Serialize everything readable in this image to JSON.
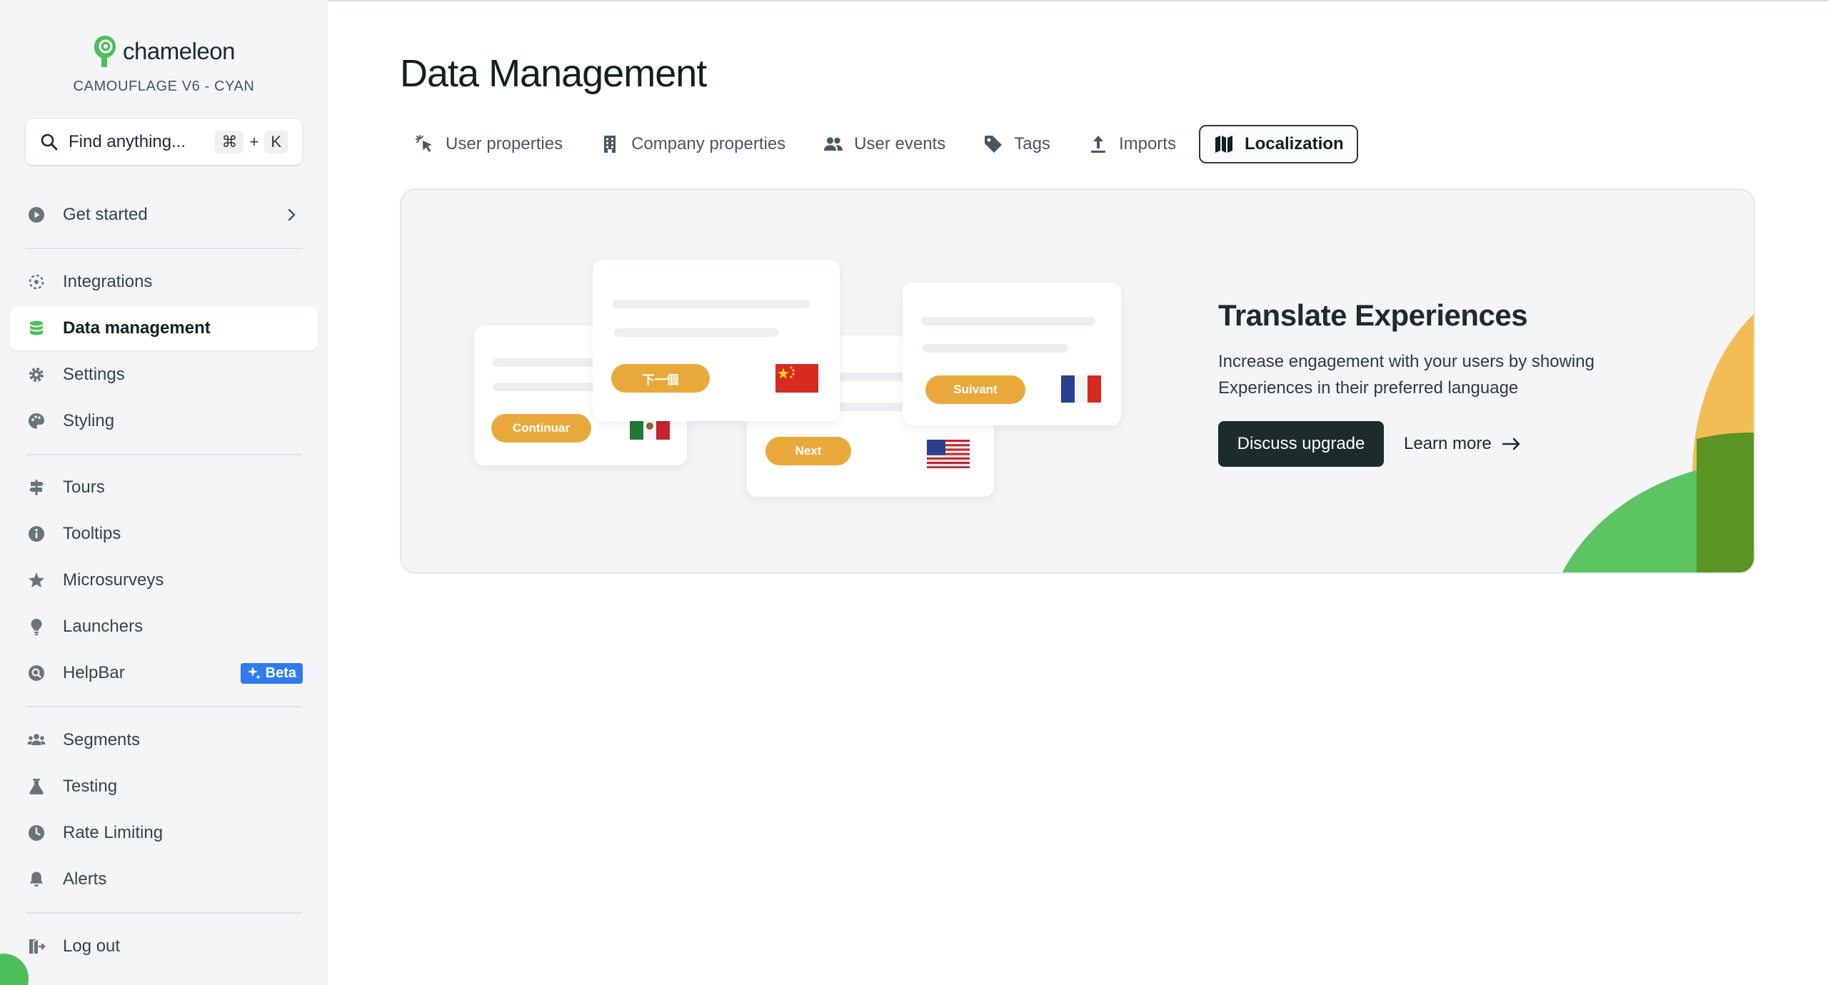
{
  "brand": {
    "name": "chameleon",
    "workspace": "CAMOUFLAGE V6 - CYAN"
  },
  "search": {
    "placeholder": "Find anything...",
    "shortcut_mod": "⌘",
    "shortcut_plus": "+",
    "shortcut_key": "K"
  },
  "sidebar": {
    "get_started": "Get started",
    "items": [
      {
        "label": "Integrations",
        "icon": "integrations-icon"
      },
      {
        "label": "Data management",
        "icon": "database-icon",
        "active": true
      },
      {
        "label": "Settings",
        "icon": "gear-icon"
      },
      {
        "label": "Styling",
        "icon": "palette-icon"
      },
      {
        "label": "Tours",
        "icon": "signpost-icon"
      },
      {
        "label": "Tooltips",
        "icon": "info-icon"
      },
      {
        "label": "Microsurveys",
        "icon": "star-icon"
      },
      {
        "label": "Launchers",
        "icon": "lightbulb-icon"
      },
      {
        "label": "HelpBar",
        "icon": "helpbar-icon",
        "badge": "Beta"
      },
      {
        "label": "Segments",
        "icon": "users-icon"
      },
      {
        "label": "Testing",
        "icon": "flask-icon"
      },
      {
        "label": "Rate Limiting",
        "icon": "clock-icon"
      },
      {
        "label": "Alerts",
        "icon": "bell-icon"
      },
      {
        "label": "Log out",
        "icon": "logout-icon"
      }
    ]
  },
  "main": {
    "title": "Data Management",
    "tabs": [
      {
        "label": "User properties",
        "icon": "pointer-click-icon"
      },
      {
        "label": "Company properties",
        "icon": "building-icon"
      },
      {
        "label": "User events",
        "icon": "users-icon"
      },
      {
        "label": "Tags",
        "icon": "tag-icon"
      },
      {
        "label": "Imports",
        "icon": "upload-icon"
      },
      {
        "label": "Localization",
        "icon": "map-icon",
        "active": true
      }
    ]
  },
  "promo": {
    "title": "Translate Experiences",
    "description": "Increase engagement with your users by showing Experiences in their preferred language",
    "cta_label": "Discuss upgrade",
    "learn_label": "Learn more",
    "cards": [
      {
        "button": "Continuar",
        "flag": "mexico-flag"
      },
      {
        "button": "下一個",
        "flag": "china-flag"
      },
      {
        "button": "Next",
        "flag": "usa-flag"
      },
      {
        "button": "Suivant",
        "flag": "france-flag"
      }
    ]
  },
  "colors": {
    "accent_green": "#4dbf5a",
    "pill_orange": "#e9a93a",
    "cta_dark": "#1c2c2a",
    "beta_blue": "#2f7bef",
    "blob_yellow": "#f2bd55",
    "blob_dark_green": "#5a9423"
  }
}
